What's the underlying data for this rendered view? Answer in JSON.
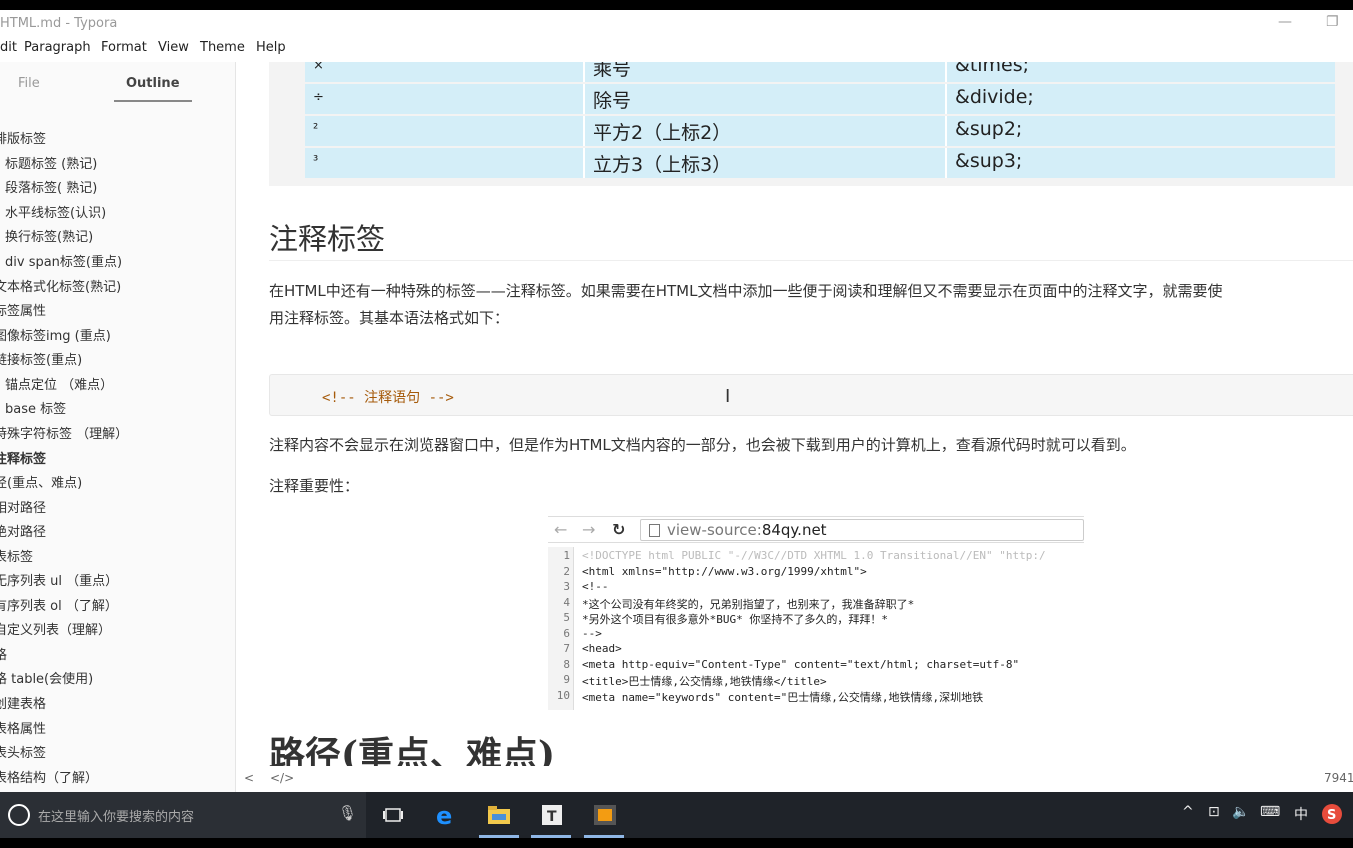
{
  "window": {
    "title": "HTML.md - Typora",
    "minimize": "—",
    "restore": "❐"
  },
  "menu": [
    "dit",
    "Paragraph",
    "Format",
    "View",
    "Theme",
    "Help"
  ],
  "sidebar": {
    "tabs": {
      "file": "File",
      "outline": "Outline"
    },
    "items": [
      "排版标签",
      "标题标签 (熟记)",
      "段落标签( 熟记)",
      "水平线标签(认识)",
      "换行标签(熟记)",
      "div span标签(重点)",
      "文本格式化标签(熟记)",
      "标签属性",
      "图像标签img (重点)",
      "链接标签(重点)",
      "锚点定位 （难点）",
      "base 标签",
      "特殊字符标签 （理解）",
      "注释标签",
      "径(重点、难点)",
      "相对路径",
      "绝对路径",
      "表标签",
      "无序列表 ul （重点）",
      "有序列表 ol （了解）",
      "自定义列表（理解）",
      "格",
      "格 table(会使用)",
      "创建表格",
      "表格属性",
      "表头标签",
      "表格结构（了解）"
    ]
  },
  "table": {
    "rows": [
      {
        "sym": "×",
        "name": "乘号",
        "code": "&times;"
      },
      {
        "sym": "÷",
        "name": "除号",
        "code": "&divide;"
      },
      {
        "sym": "²",
        "name": "平方2（上标2）",
        "code": "&sup2;"
      },
      {
        "sym": "³",
        "name": "立方3（上标3）",
        "code": "&sup3;"
      }
    ]
  },
  "section_title": "注释标签",
  "para1_line1": "在HTML中还有一种特殊的标签——注释标签。如果需要在HTML文档中添加一些便于阅读和理解但又不需要显示在页面中的注释文字，就需要使",
  "para1_line2": "用注释标签。其基本语法格式如下：",
  "code_text": "<!-- 注释语句 -->",
  "para2": "注释内容不会显示在浏览器窗口中，但是作为HTML文档内容的一部分，也会被下载到用户的计算机上，查看源代码时就可以看到。",
  "para3": "注释重要性：",
  "screenshot": {
    "url_prefix": "view-source:",
    "url_host": "84qy.net",
    "lines": [
      {
        "n": "1",
        "t": "<!DOCTYPE html PUBLIC \"-//W3C//DTD XHTML 1.0 Transitional//EN\" \"http:/"
      },
      {
        "n": "2",
        "t": "<html xmlns=\"http://www.w3.org/1999/xhtml\">"
      },
      {
        "n": "3",
        "t": "<!--"
      },
      {
        "n": "4",
        "t": "*这个公司没有年终奖的，兄弟别指望了，也别来了，我准备辞职了*"
      },
      {
        "n": "5",
        "t": "*另外这个项目有很多意外*BUG* 你坚持不了多久的，拜拜！*"
      },
      {
        "n": "6",
        "t": "-->"
      },
      {
        "n": "7",
        "t": "<head>"
      },
      {
        "n": "8",
        "t": "    <meta http-equiv=\"Content-Type\" content=\"text/html; charset=utf-8\""
      },
      {
        "n": "9",
        "t": "    <title>巴士情缘,公交情缘,地铁情缘</title>"
      },
      {
        "n": "10",
        "t": "    <meta name=\"keywords\" content=\"巴士情缘,公交情缘,地铁情缘,深圳地铁"
      }
    ]
  },
  "h1_next": "路径(重点、难点)",
  "status": {
    "left_arrow": "<",
    "code_toggle": "</>",
    "word_count": "7941"
  },
  "taskbar": {
    "search_placeholder": "在这里输入你要搜索的内容",
    "ime": "中"
  }
}
